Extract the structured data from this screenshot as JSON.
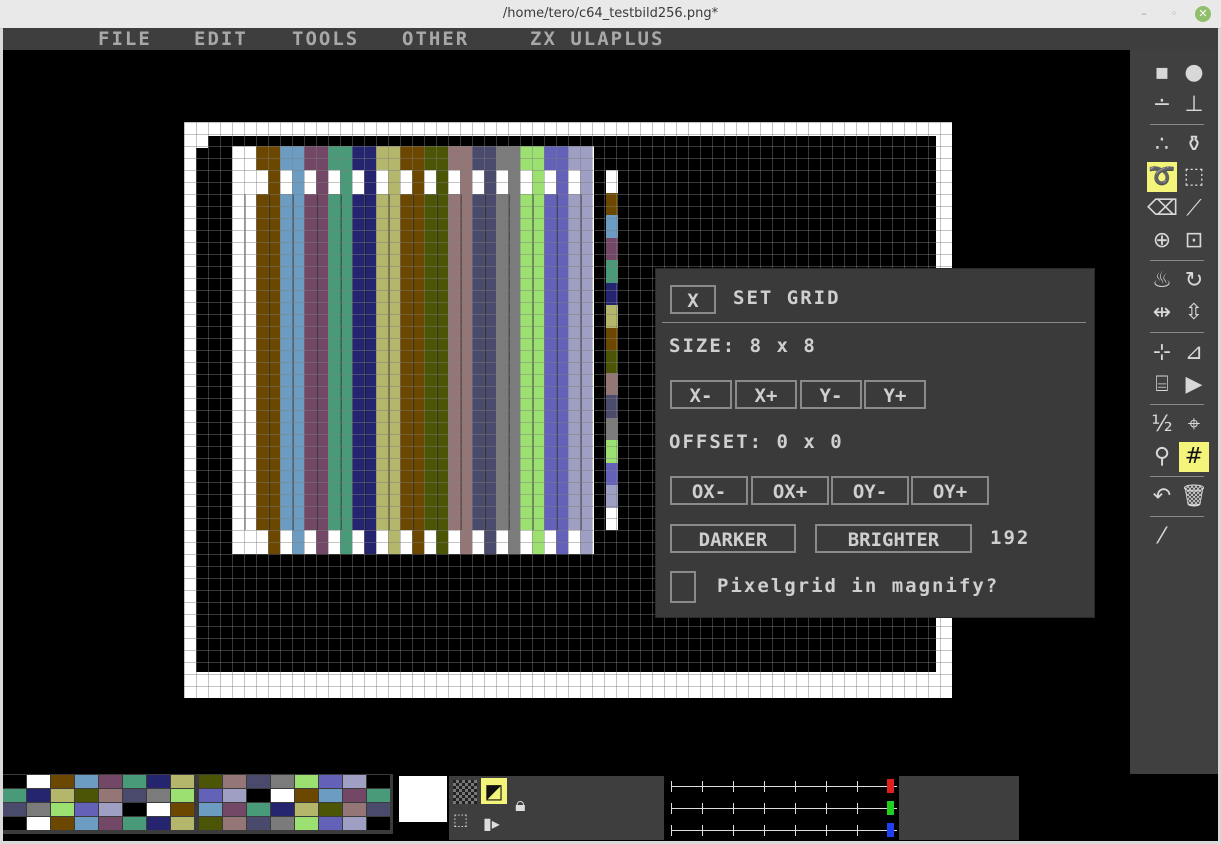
{
  "window": {
    "title": "/home/tero/c64_testbild256.png*",
    "minimize_glyph": "–",
    "maximize_glyph": "◦",
    "close_glyph": "✕"
  },
  "menu": {
    "items": [
      "FILE",
      "EDIT",
      "TOOLS",
      "OTHER",
      "ZX ULAPLUS"
    ]
  },
  "image": {
    "bar_colors": [
      "#6c4700",
      "#6d9cc2",
      "#734866",
      "#489a78",
      "#24246f",
      "#b4b66b",
      "#6c4700",
      "#4c5406",
      "#957676",
      "#4a4a6c",
      "#7b7b7b",
      "#9be071",
      "#6461b8",
      "#9e9fc3"
    ],
    "side_colors": [
      "#ffffff",
      "#6c4700",
      "#6d9cc2",
      "#734866",
      "#489a78",
      "#24246f",
      "#b4b66b",
      "#6c4700",
      "#4c5406",
      "#957676",
      "#4a4a6c",
      "#7b7b7b",
      "#9be071",
      "#6461b8",
      "#9e9fc3",
      "#ffffff"
    ]
  },
  "tools": [
    "pixel-icon",
    "brush-sizes-icon",
    "line-icon",
    "stamp-icon",
    "spray-icon",
    "fill-spray-icon",
    "lasso-icon",
    "rect-select-icon",
    "eraser-icon",
    "magic-wand-icon",
    "circle-icon",
    "resize-icon",
    "fill-icon",
    "rotate-icon",
    "flip-h-icon",
    "flip-v-icon",
    "mirror-x-icon",
    "mirror-y-icon",
    "mirror-xy-icon",
    "play-icon",
    "half-icon",
    "crosshair-icon",
    "magnify-icon",
    "grid-icon",
    "undo-icon",
    "trash-icon",
    "eyedropper-icon"
  ],
  "dialog": {
    "close_label": "X",
    "title": "SET GRID",
    "size_label": "SIZE: 8 x 8",
    "size_buttons": [
      "X-",
      "X+",
      "Y-",
      "Y+"
    ],
    "offset_label": "OFFSET: 0 x 0",
    "offset_buttons": [
      "OX-",
      "OX+",
      "OY-",
      "OY+"
    ],
    "darker_label": "DARKER",
    "brighter_label": "BRIGHTER",
    "brightness_value": "192",
    "checkbox_label": "Pixelgrid in magnify?",
    "checkbox_checked": false
  },
  "palette": {
    "colors": [
      "#000000",
      "#ffffff",
      "#6c4700",
      "#6d9cc2",
      "#734866",
      "#489a78",
      "#24246f",
      "#b4b66b",
      "#4c5406",
      "#957676",
      "#4a4a6c",
      "#7b7b7b",
      "#9be071",
      "#6461b8",
      "#9e9fc3"
    ]
  },
  "sliders": [
    {
      "name": "red",
      "color": "#e02020",
      "level": 1.0
    },
    {
      "name": "green",
      "color": "#20d020",
      "level": 1.0
    },
    {
      "name": "blue",
      "color": "#2040f0",
      "level": 1.0
    }
  ],
  "current_color": "#ffffff"
}
